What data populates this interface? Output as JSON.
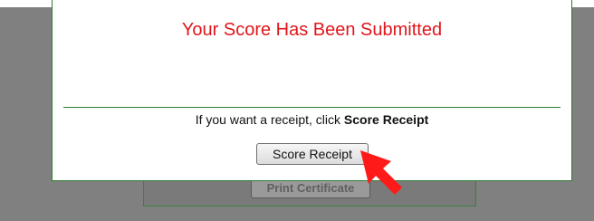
{
  "underlying_page": {
    "button_label": "Print Certificate"
  },
  "dialog": {
    "title": "Your Score Has Been Submitted",
    "receipt_prompt": "If you want a receipt, click ",
    "receipt_prompt_bold": "Score Receipt",
    "receipt_button_label": "Score Receipt"
  },
  "annotation": {
    "arrow_icon": "red-pointer-arrow-icon",
    "arrow_color": "#ff1a1a"
  },
  "colors": {
    "title": "#e0161c",
    "border": "#2e7d32",
    "overlay": "#808080"
  }
}
